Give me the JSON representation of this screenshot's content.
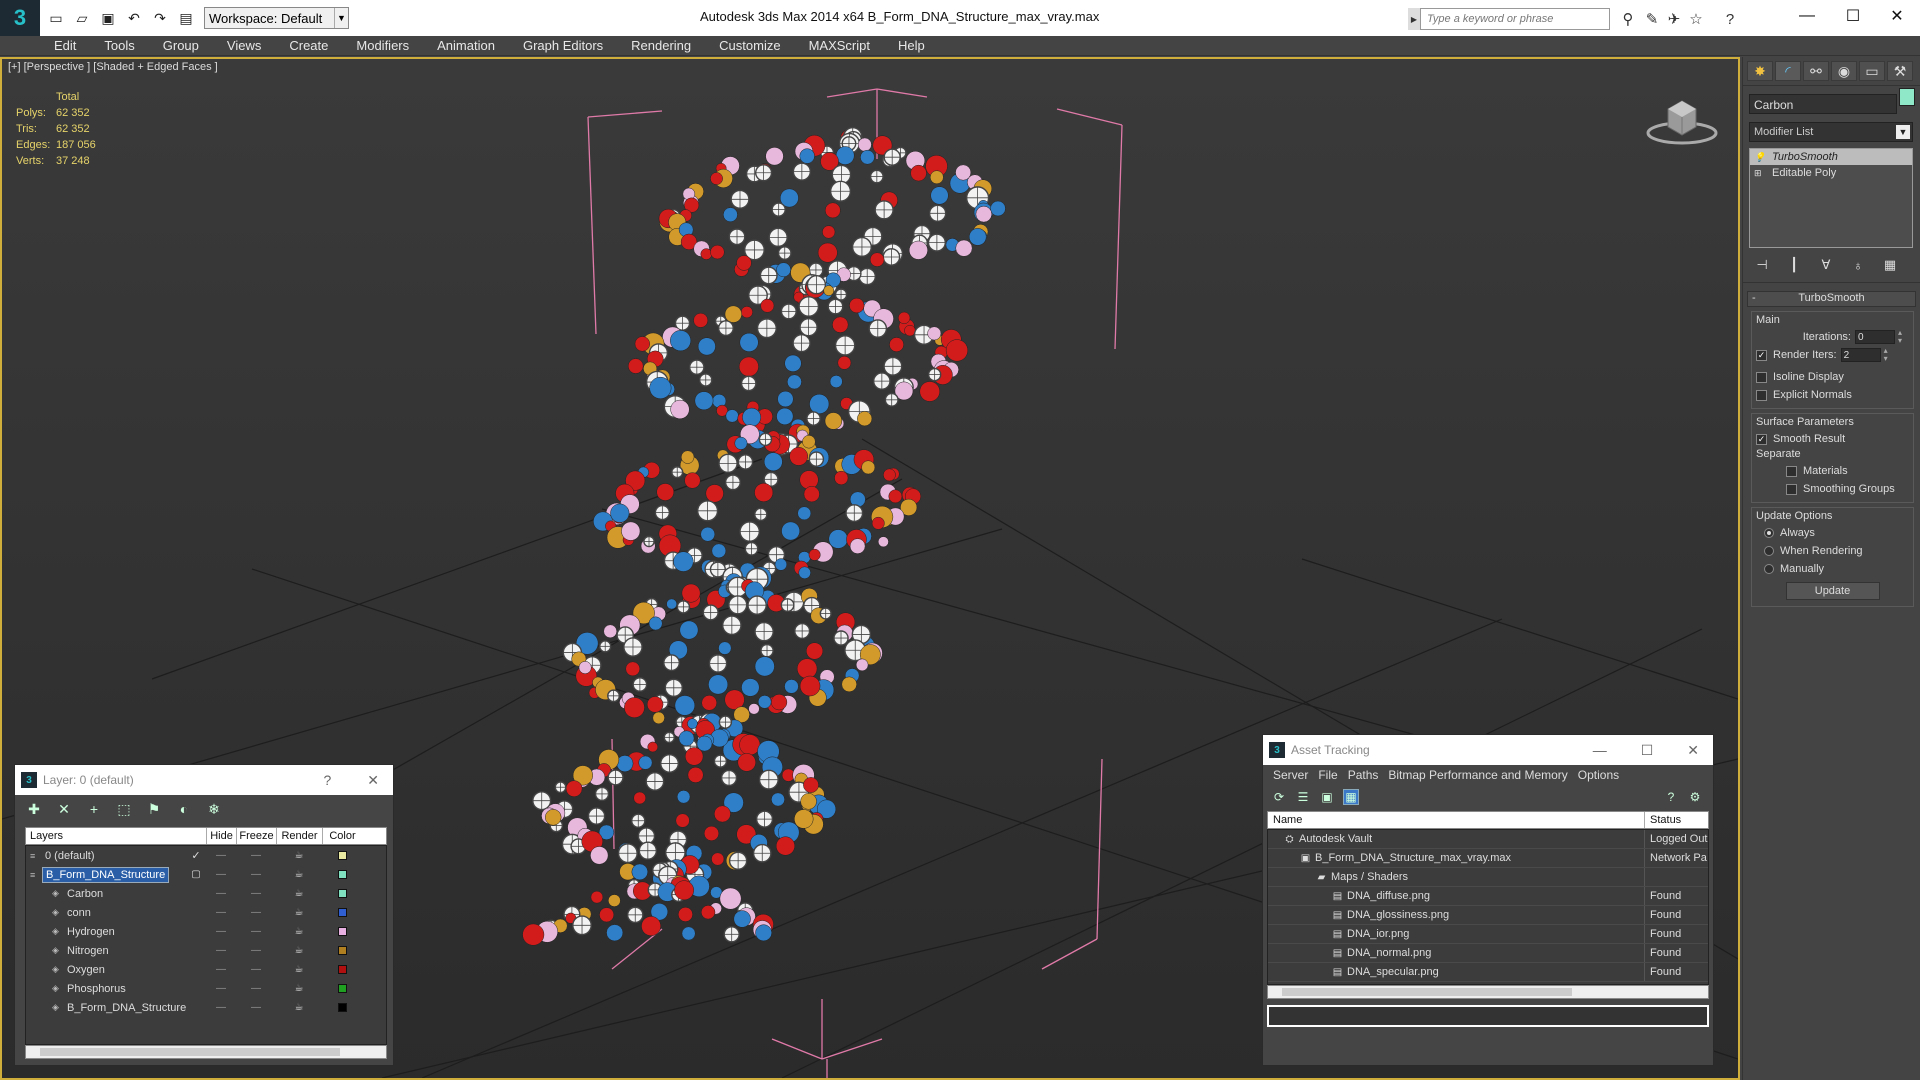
{
  "window": {
    "title": "Autodesk 3ds Max  2014 x64     B_Form_DNA_Structure_max_vray.max",
    "workspace": "Workspace: Default",
    "search_placeholder": "Type a keyword or phrase"
  },
  "menu": [
    "Edit",
    "Tools",
    "Group",
    "Views",
    "Create",
    "Modifiers",
    "Animation",
    "Graph Editors",
    "Rendering",
    "Customize",
    "MAXScript",
    "Help"
  ],
  "viewport": {
    "label": "[+] [Perspective ] [Shaded + Edged Faces ]",
    "stats": {
      "header": "Total",
      "rows": [
        {
          "k": "Polys:",
          "v": "62 352"
        },
        {
          "k": "Tris:",
          "v": "62 352"
        },
        {
          "k": "Edges:",
          "v": "187 056"
        },
        {
          "k": "Verts:",
          "v": "37 248"
        }
      ]
    }
  },
  "command_panel": {
    "object_name": "Carbon",
    "object_color": "#8fe8c8",
    "modifier_list": "Modifier List",
    "stack": [
      "TurboSmooth",
      "Editable Poly"
    ],
    "rollout": "TurboSmooth",
    "main_label": "Main",
    "iterations_label": "Iterations:",
    "iterations": "0",
    "render_iters_label": "Render Iters:",
    "render_iters": "2",
    "isoline": "Isoline Display",
    "explicit_normals": "Explicit Normals",
    "surface_label": "Surface Parameters",
    "smooth_result": "Smooth Result",
    "separate_label": "Separate",
    "materials": "Materials",
    "smoothing_groups": "Smoothing Groups",
    "update_label": "Update Options",
    "always": "Always",
    "when_rendering": "When Rendering",
    "manually": "Manually",
    "update_button": "Update"
  },
  "layer_dialog": {
    "title": "Layer: 0 (default)",
    "headers": {
      "layers": "Layers",
      "hide": "Hide",
      "freeze": "Freeze",
      "render": "Render",
      "color": "Color"
    },
    "rows": [
      {
        "name": "0 (default)",
        "color": "#e8e8a0",
        "indent": 0,
        "sel": false,
        "check": true
      },
      {
        "name": "B_Form_DNA_Structure",
        "color": "#7fe0c0",
        "indent": 0,
        "sel": true,
        "check": false
      },
      {
        "name": "Carbon",
        "color": "#7fe0c0",
        "indent": 1,
        "sel": false,
        "check": false
      },
      {
        "name": "conn",
        "color": "#2f5fd0",
        "indent": 1,
        "sel": false,
        "check": false
      },
      {
        "name": "Hydrogen",
        "color": "#e8b0e0",
        "indent": 1,
        "sel": false,
        "check": false
      },
      {
        "name": "Nitrogen",
        "color": "#b08020",
        "indent": 1,
        "sel": false,
        "check": false
      },
      {
        "name": "Oxygen",
        "color": "#b01010",
        "indent": 1,
        "sel": false,
        "check": false
      },
      {
        "name": "Phosphorus",
        "color": "#20a020",
        "indent": 1,
        "sel": false,
        "check": false
      },
      {
        "name": "B_Form_DNA_Structure",
        "color": "#000000",
        "indent": 1,
        "sel": false,
        "check": false
      }
    ]
  },
  "asset_dialog": {
    "title": "Asset Tracking",
    "menu": [
      "Server",
      "File",
      "Paths",
      "Bitmap Performance and Memory",
      "Options"
    ],
    "headers": {
      "name": "Name",
      "status": "Status"
    },
    "rows": [
      {
        "name": "Autodesk Vault",
        "status": "Logged Out",
        "indent": 1
      },
      {
        "name": "B_Form_DNA_Structure_max_vray.max",
        "status": "Network Pa",
        "indent": 2
      },
      {
        "name": "Maps / Shaders",
        "status": "",
        "indent": 3
      },
      {
        "name": "DNA_diffuse.png",
        "status": "Found",
        "indent": 4
      },
      {
        "name": "DNA_glossiness.png",
        "status": "Found",
        "indent": 4
      },
      {
        "name": "DNA_ior.png",
        "status": "Found",
        "indent": 4
      },
      {
        "name": "DNA_normal.png",
        "status": "Found",
        "indent": 4
      },
      {
        "name": "DNA_specular.png",
        "status": "Found",
        "indent": 4
      }
    ]
  }
}
